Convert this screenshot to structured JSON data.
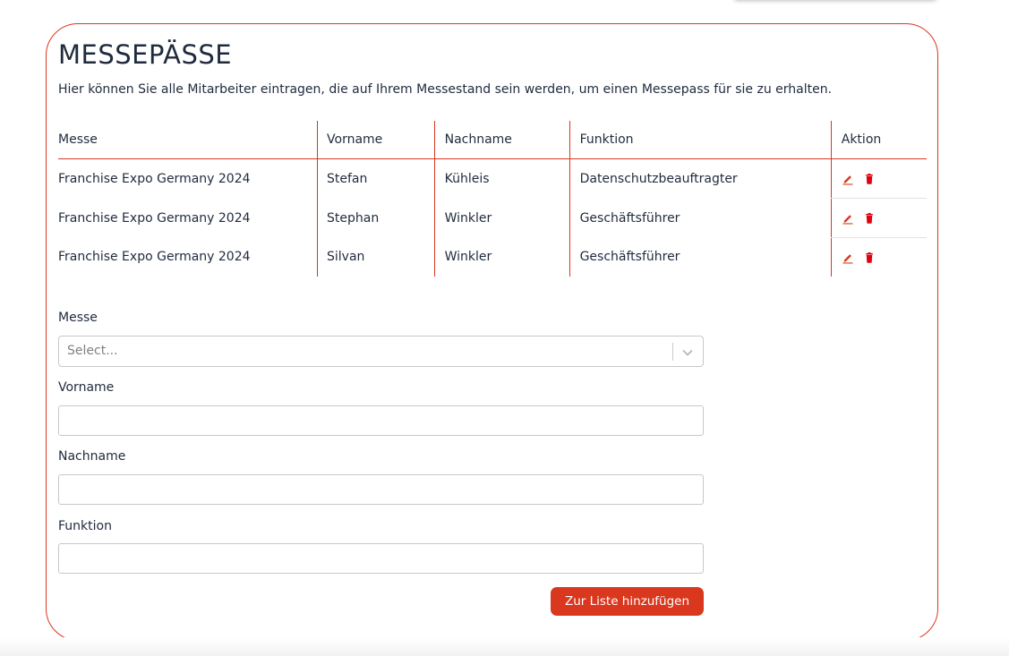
{
  "section": {
    "title": "MESSEPÄSSE",
    "intro": "Hier können Sie alle Mitarbeiter eintragen, die auf Ihrem Messestand sein werden, um einen Messepass für sie zu erhalten."
  },
  "table": {
    "headers": {
      "messe": "Messe",
      "vorname": "Vorname",
      "nachname": "Nachname",
      "funktion": "Funktion",
      "aktion": "Aktion"
    },
    "rows": [
      {
        "messe": "Franchise Expo Germany 2024",
        "vorname": "Stefan",
        "nachname": "Kühleis",
        "funktion": "Datenschutzbeauftragter"
      },
      {
        "messe": "Franchise Expo Germany 2024",
        "vorname": "Stephan",
        "nachname": "Winkler",
        "funktion": "Geschäftsführer"
      },
      {
        "messe": "Franchise Expo Germany 2024",
        "vorname": "Silvan",
        "nachname": "Winkler",
        "funktion": "Geschäftsführer"
      }
    ],
    "action_icons": [
      "edit-icon",
      "trash-icon"
    ]
  },
  "form": {
    "messe_label": "Messe",
    "messe_placeholder": "Select...",
    "vorname_label": "Vorname",
    "vorname_value": "",
    "nachname_label": "Nachname",
    "nachname_value": "",
    "funktion_label": "Funktion",
    "funktion_value": "",
    "submit_label": "Zur Liste hinzufügen"
  },
  "colors": {
    "accent": "#d9381e",
    "text": "#1f2b3d",
    "border": "#c8c8c8"
  }
}
